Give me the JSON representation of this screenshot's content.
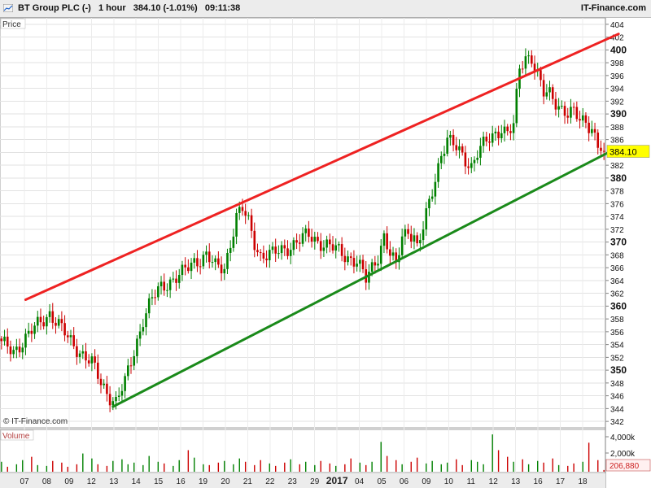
{
  "header": {
    "instrument": "BT Group PLC (-)",
    "timeframe": "1 hour",
    "last_change": "384.10 (-1.01%)",
    "time": "09:11:38",
    "brand": "IT-Finance.com"
  },
  "price_panel": {
    "label": "Price",
    "copyright": "© IT-Finance.com",
    "last_price_badge": "384.10"
  },
  "volume_panel": {
    "label": "Volume",
    "ticks": [
      "4,000k",
      "2,000k"
    ],
    "last_volume_badge": "206,880"
  },
  "x_axis": {
    "labels": [
      "07",
      "08",
      "09",
      "12",
      "13",
      "14",
      "15",
      "16",
      "19",
      "20",
      "21",
      "22",
      "23",
      "29",
      "2017",
      "04",
      "05",
      "06",
      "09",
      "10",
      "11",
      "12",
      "13",
      "16",
      "17",
      "18"
    ]
  },
  "colors": {
    "up_candle": "#008000",
    "down_candle": "#cc0000",
    "resistance_line": "#ee2222",
    "support_line": "#1a8a1a",
    "badge_bg": "#ffff00"
  },
  "chart_data": {
    "type": "candlestick",
    "title": "BT Group PLC (-) 1 hour",
    "ylabel": "Price",
    "ylim": [
      341,
      405
    ],
    "y_ticks": [
      342,
      344,
      346,
      348,
      350,
      352,
      354,
      356,
      358,
      360,
      362,
      364,
      366,
      368,
      370,
      372,
      374,
      376,
      378,
      380,
      382,
      384,
      386,
      388,
      390,
      392,
      394,
      396,
      398,
      400,
      402,
      404
    ],
    "y_ticks_major": [
      350,
      360,
      370,
      380,
      390,
      400
    ],
    "close_path": [
      [
        0,
        354
      ],
      [
        4,
        353
      ],
      [
        8,
        355
      ],
      [
        12,
        357
      ],
      [
        16,
        359
      ],
      [
        19,
        357
      ],
      [
        22,
        355
      ],
      [
        26,
        353
      ],
      [
        30,
        351
      ],
      [
        33,
        348
      ],
      [
        36,
        346
      ],
      [
        38,
        345
      ],
      [
        41,
        348
      ],
      [
        44,
        353
      ],
      [
        47,
        358
      ],
      [
        50,
        361
      ],
      [
        53,
        363
      ],
      [
        56,
        364
      ],
      [
        60,
        365
      ],
      [
        64,
        367
      ],
      [
        68,
        368
      ],
      [
        71,
        366
      ],
      [
        74,
        366
      ],
      [
        76,
        370
      ],
      [
        78,
        374
      ],
      [
        80,
        375
      ],
      [
        82,
        373
      ],
      [
        84,
        370
      ],
      [
        86,
        368
      ],
      [
        90,
        368
      ],
      [
        94,
        369
      ],
      [
        98,
        370
      ],
      [
        102,
        371
      ],
      [
        106,
        370
      ],
      [
        110,
        369
      ],
      [
        114,
        368
      ],
      [
        118,
        367
      ],
      [
        121,
        364
      ],
      [
        123,
        366
      ],
      [
        125,
        368
      ],
      [
        127,
        371
      ],
      [
        129,
        368
      ],
      [
        131,
        366
      ],
      [
        133,
        371
      ],
      [
        135,
        372
      ],
      [
        137,
        371
      ],
      [
        138,
        369
      ],
      [
        140,
        372
      ],
      [
        142,
        376
      ],
      [
        144,
        380
      ],
      [
        146,
        384
      ],
      [
        148,
        386
      ],
      [
        150,
        385
      ],
      [
        152,
        384
      ],
      [
        154,
        383
      ],
      [
        156,
        382
      ],
      [
        158,
        384
      ],
      [
        160,
        385
      ],
      [
        162,
        386
      ],
      [
        164,
        387
      ],
      [
        166,
        388
      ],
      [
        168,
        387
      ],
      [
        170,
        388
      ],
      [
        172,
        397
      ],
      [
        174,
        399
      ],
      [
        176,
        399
      ],
      [
        178,
        396
      ],
      [
        180,
        393
      ],
      [
        182,
        393
      ],
      [
        184,
        392
      ],
      [
        186,
        391
      ],
      [
        188,
        390
      ],
      [
        190,
        390
      ],
      [
        192,
        389
      ],
      [
        194,
        389
      ],
      [
        196,
        388
      ],
      [
        198,
        385
      ],
      [
        200,
        384.1
      ]
    ],
    "volume_k_approx": [
      1200,
      600,
      900,
      1400,
      1800,
      800,
      700,
      1300,
      1100,
      600,
      900,
      2200,
      1600,
      900,
      700,
      1300,
      1500,
      900,
      1100,
      800,
      1900,
      1200,
      1000,
      700,
      1400,
      2600,
      1700,
      900,
      800,
      1100,
      1300,
      900,
      1600,
      1200,
      800,
      1400,
      1000,
      700,
      1100,
      1500,
      900,
      1200,
      800,
      1300,
      1000,
      700,
      900,
      1600,
      1100,
      800,
      1200,
      3600,
      1900,
      1400,
      900,
      1200,
      1700,
      1000,
      1300,
      900,
      1100,
      1500,
      800,
      1400,
      1200,
      900,
      4500,
      2600,
      1800,
      1200,
      1500,
      900,
      1300,
      1100,
      1600,
      800,
      700,
      1000,
      1200,
      3500,
      1400,
      206.88
    ],
    "trendlines": [
      {
        "name": "resistance",
        "color": "#ee2222",
        "from": [
          8,
          361
        ],
        "to": [
          200,
          402.5
        ]
      },
      {
        "name": "support",
        "color": "#1a8a1a",
        "from": [
          37,
          344.3
        ],
        "to": [
          200,
          384.8
        ]
      }
    ],
    "last_price": 384.1,
    "last_change_pct": -1.01
  }
}
